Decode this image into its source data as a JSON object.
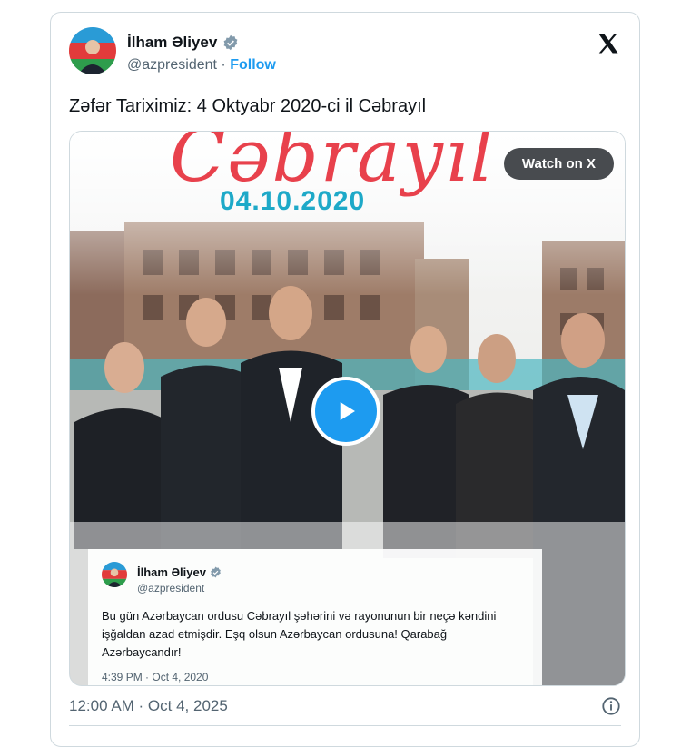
{
  "author": {
    "name": "İlham Əliyev",
    "handle": "@azpresident",
    "separator": "·",
    "follow_label": "Follow"
  },
  "tweet": {
    "text": "Zəfər Tariximiz: 4 Oktyabr 2020-ci il Cəbrayıl",
    "timestamp": "12:00 AM · Oct 4, 2025"
  },
  "media": {
    "watch_label": "Watch on X",
    "headline": "Cəbrayıl",
    "headline_date": "04.10.2020"
  },
  "quoted": {
    "name": "İlham Əliyev",
    "handle": "@azpresident",
    "body": "Bu gün Azərbaycan ordusu Cəbrayıl şəhərini  və rayonunun bir neçə kəndini işğaldan azad etmişdir. Eşq olsun Azərbaycan ordusuna! Qarabağ Azərbaycandır!",
    "timestamp": "4:39 PM · Oct 4, 2020"
  },
  "icons": {
    "verified": "verified-badge-icon",
    "platform": "x-logo-icon",
    "play": "play-icon",
    "info": "info-icon"
  },
  "colors": {
    "accent": "#1d9bf0",
    "headline_red": "#e8414c",
    "headline_teal": "#1ea9c8"
  }
}
